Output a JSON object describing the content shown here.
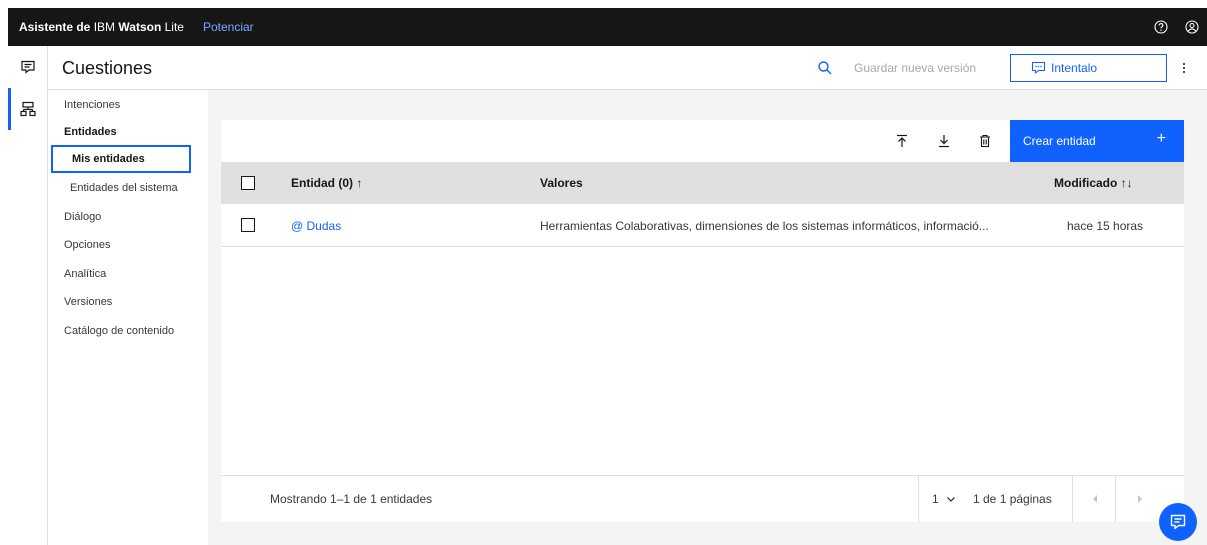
{
  "topbar": {
    "brand_prefix": "Asistente de",
    "brand_ibm": "IBM",
    "brand_watson": "Watson",
    "brand_plan": "Lite",
    "upgrade_link": "Potenciar",
    "icons": [
      "help-icon",
      "user-avatar-icon"
    ]
  },
  "rail": {
    "items": [
      {
        "name": "assistant-chat-icon",
        "active": false
      },
      {
        "name": "skills-tree-icon",
        "active": true
      }
    ]
  },
  "header": {
    "title": "Cuestiones",
    "save_version": "Guardar nueva versión",
    "try_button": "Intentalo"
  },
  "sidenav": {
    "intents": "Intenciones",
    "entities": "Entidades",
    "my_entities": "Mis entidades",
    "system_entities": "Entidades del sistema",
    "dialog": "Diálogo",
    "options": "Opciones",
    "analytics": "Analítica",
    "versions": "Versiones",
    "content_catalog": "Catálogo de contenido"
  },
  "toolbar": {
    "icons": [
      "upload-icon",
      "download-icon",
      "delete-icon"
    ],
    "create_button": "Crear entidad",
    "create_plus": "+"
  },
  "table": {
    "columns": [
      "Entidad (0) ↑",
      "Valores",
      "Modificado ⇅"
    ],
    "col_entity": "Entidad (0) ↑",
    "col_values": "Valores",
    "col_modified": "Modificado ↑↓",
    "rows": [
      {
        "entity": "@ Dudas",
        "values": "Herramientas Colaborativas, dimensiones de los sistemas informáticos, informació...",
        "modified": "hace 15 horas"
      }
    ]
  },
  "pagination": {
    "showing": "Mostrando 1–1 de 1 entidades",
    "page": "1",
    "page_of": "1 de 1 páginas"
  },
  "colors": {
    "accent": "#0f62fe",
    "topbar_bg": "#161616",
    "upgrade_link": "#78a9ff",
    "content_bg": "#f4f4f4",
    "header_row_bg": "#e0e0e0"
  }
}
